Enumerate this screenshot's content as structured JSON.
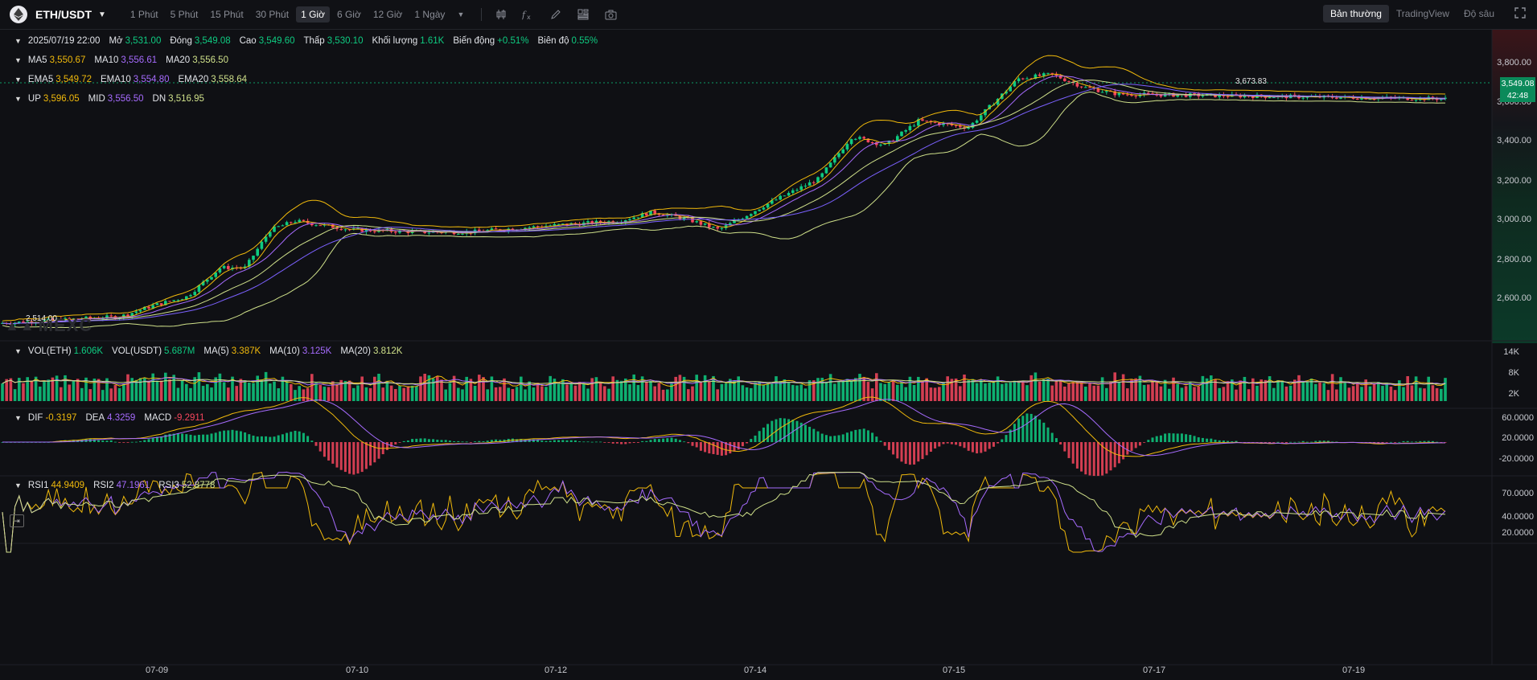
{
  "toolbar": {
    "pair": "ETH/USDT",
    "intervals": [
      "1 Phút",
      "5 Phút",
      "15 Phút",
      "30 Phút",
      "1 Giờ",
      "6 Giờ",
      "12 Giờ",
      "1 Ngày"
    ],
    "active_interval": "1 Giờ",
    "modes": [
      "Bản thường",
      "TradingView",
      "Độ sâu"
    ],
    "active_mode": "Bản thường",
    "tool_icons": [
      "candle-type-icon",
      "indicator-fx-icon",
      "draw-pencil-icon",
      "layout-grid-icon",
      "camera-icon"
    ]
  },
  "ohlc": {
    "date": "2025/07/19 22:00",
    "open_label": "Mở",
    "open": "3,531.00",
    "close_label": "Đóng",
    "close": "3,549.08",
    "high_label": "Cao",
    "high": "3,549.60",
    "low_label": "Thấp",
    "low": "3,530.10",
    "volume_label": "Khối lượng",
    "volume": "1.61K",
    "change_label": "Biến động",
    "change": "+0.51%",
    "amplitude_label": "Biên độ",
    "amplitude": "0.55%"
  },
  "ma": {
    "ma5_label": "MA5",
    "ma5": "3,550.67",
    "ma10_label": "MA10",
    "ma10": "3,556.61",
    "ma20_label": "MA20",
    "ma20": "3,556.50"
  },
  "ema": {
    "ema5_label": "EMA5",
    "ema5": "3,549.72",
    "ema10_label": "EMA10",
    "ema10": "3,554.80",
    "ema20_label": "EMA20",
    "ema20": "3,558.64"
  },
  "boll": {
    "up_label": "UP",
    "up": "3,596.05",
    "mid_label": "MID",
    "mid": "3,556.50",
    "dn_label": "DN",
    "dn": "3,516.95"
  },
  "vol": {
    "eth_label": "VOL(ETH)",
    "eth": "1.606K",
    "usdt_label": "VOL(USDT)",
    "usdt": "5.687M",
    "ma5_label": "MA(5)",
    "ma5": "3.387K",
    "ma10_label": "MA(10)",
    "ma10": "3.125K",
    "ma20_label": "MA(20)",
    "ma20": "3.812K"
  },
  "macd": {
    "dif_label": "DIF",
    "dif": "-0.3197",
    "dea_label": "DEA",
    "dea": "4.3259",
    "macd_label": "MACD",
    "macd": "-9.2911"
  },
  "rsi": {
    "rsi1_label": "RSI1",
    "rsi1": "44.9409",
    "rsi2_label": "RSI2",
    "rsi2": "47.1961",
    "rsi3_label": "RSI3",
    "rsi3": "52.8778"
  },
  "price_axis": [
    "3,800.00",
    "3,600.00",
    "3,400.00",
    "3,200.00",
    "3,000.00",
    "2,800.00",
    "2,600.00"
  ],
  "vol_axis": [
    "14K",
    "8K",
    "2K"
  ],
  "macd_axis": [
    "60.0000",
    "20.0000",
    "-20.0000"
  ],
  "rsi_axis": [
    "70.0000",
    "40.0000",
    "20.0000"
  ],
  "time_axis": [
    "07-09",
    "07-10",
    "07-12",
    "07-14",
    "07-15",
    "07-17",
    "07-19"
  ],
  "current_price": "3,549.08",
  "countdown": "42:48",
  "high_marker": "3,673.83",
  "low_marker": "2,514.00",
  "watermark": "MEXC",
  "colors": {
    "up": "#0ecb81",
    "down": "#f6465d",
    "ma5": "#f0b90b",
    "ma10": "#a66bfe",
    "ma20": "#cfe08a",
    "bg": "#0f1014"
  },
  "chart_data": {
    "type": "candlestick",
    "interval": "1 Giờ",
    "x": [
      "07-09",
      "07-10",
      "07-12",
      "07-14",
      "07-15",
      "07-17",
      "07-19"
    ],
    "close_path": [
      [
        "07-08",
        2540
      ],
      [
        "07-09",
        2570
      ],
      [
        "07-09",
        2620
      ],
      [
        "07-09",
        2660
      ],
      [
        "07-10",
        2790
      ],
      [
        "07-10",
        2790
      ],
      [
        "07-10",
        2960
      ],
      [
        "07-10",
        3000
      ],
      [
        "07-11",
        2960
      ],
      [
        "07-12",
        2950
      ],
      [
        "07-12",
        2950
      ],
      [
        "07-13",
        2980
      ],
      [
        "07-14",
        3000
      ],
      [
        "07-14",
        3040
      ],
      [
        "07-14",
        3010
      ],
      [
        "07-15",
        2960
      ],
      [
        "07-15",
        3080
      ],
      [
        "07-16",
        3190
      ],
      [
        "07-16",
        3380
      ],
      [
        "07-16",
        3340
      ],
      [
        "07-17",
        3450
      ],
      [
        "07-17",
        3420
      ],
      [
        "07-18",
        3640
      ],
      [
        "07-18",
        3660
      ],
      [
        "07-18",
        3600
      ],
      [
        "07-19",
        3570
      ],
      [
        "07-19",
        3549.08
      ]
    ],
    "ylim": [
      2450,
      3860
    ]
  }
}
